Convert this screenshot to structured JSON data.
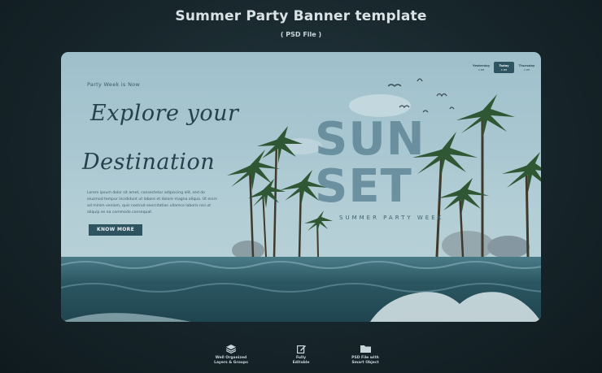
{
  "header": {
    "title": "Summer Party Banner template",
    "subtitle": "( PSD File )"
  },
  "banner": {
    "eyebrow": "Party Week is Now",
    "headline_line1": "Explore your",
    "headline_line2": "Destination",
    "body_lines": [
      "Lorem ipsum dolor sit amet, consectetur adipiscing elit, sed do",
      "eiusmod tempor incididunt ut labore et dolore magna aliqua. Ut enim",
      "ad minim veniam, quis nostrud exercitation ullamco laboris nisi ut",
      "aliquip ex ea commodo consequat."
    ],
    "cta_label": "KNOW MORE",
    "big_line1": "SUN",
    "big_line2": "SET",
    "tagline": "SUMMER PARTY WEEK",
    "tabs": [
      {
        "label": "Yesterday",
        "sub": "0 PM",
        "active": false
      },
      {
        "label": "Today",
        "sub": "0 PM",
        "active": true
      },
      {
        "label": "Thursday",
        "sub": "0 PM",
        "active": false
      }
    ],
    "colors": {
      "sky": "#a9c7d1",
      "sea": "#2e5a66",
      "accent": "#2f5461"
    }
  },
  "features": [
    {
      "icon": "layers-icon",
      "line1": "Well Organized",
      "line2": "Layers & Groups"
    },
    {
      "icon": "edit-icon",
      "line1": "Fully",
      "line2": "Editable"
    },
    {
      "icon": "folder-icon",
      "line1": "PSD File with",
      "line2": "Smart Object"
    }
  ]
}
